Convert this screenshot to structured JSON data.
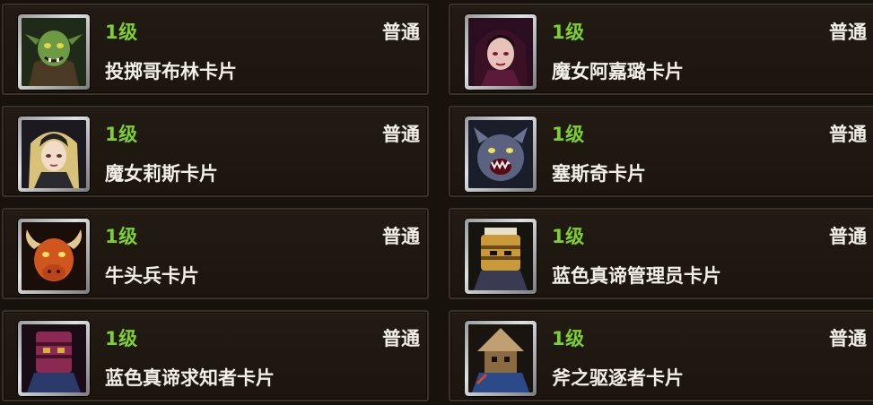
{
  "cards": [
    {
      "level": "1级",
      "rarity": "普通",
      "name": "投掷哥布林卡片",
      "icon": "goblin-portrait-icon"
    },
    {
      "level": "1级",
      "rarity": "普通",
      "name": "魔女阿嘉璐卡片",
      "icon": "witch-agatha-portrait-icon"
    },
    {
      "level": "1级",
      "rarity": "普通",
      "name": "魔女莉斯卡片",
      "icon": "witch-lis-portrait-icon"
    },
    {
      "level": "1级",
      "rarity": "普通",
      "name": "塞斯奇卡片",
      "icon": "beast-portrait-icon"
    },
    {
      "level": "1级",
      "rarity": "普通",
      "name": "牛头兵卡片",
      "icon": "minotaur-portrait-icon"
    },
    {
      "level": "1级",
      "rarity": "普通",
      "name": "蓝色真谛管理员卡片",
      "icon": "truth-administrator-portrait-icon"
    },
    {
      "level": "1级",
      "rarity": "普通",
      "name": "蓝色真谛求知者卡片",
      "icon": "truth-seeker-portrait-icon"
    },
    {
      "level": "1级",
      "rarity": "普通",
      "name": "斧之驱逐者卡片",
      "icon": "axe-expeller-portrait-icon"
    }
  ]
}
